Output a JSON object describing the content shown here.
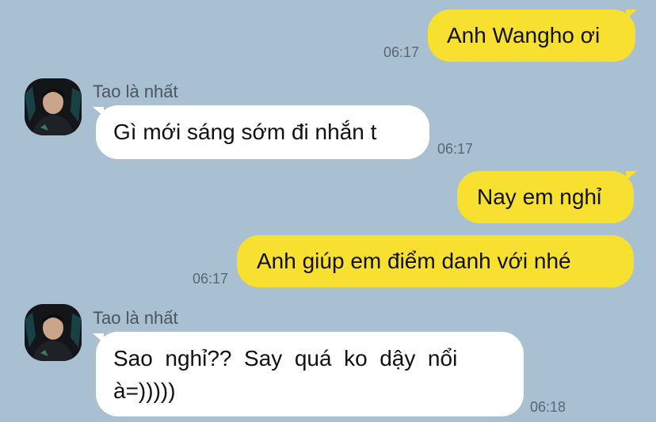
{
  "contact": {
    "name": "Tao là nhất"
  },
  "messages": [
    {
      "dir": "out",
      "text": "Anh Wangho ơi",
      "time": "06:17"
    },
    {
      "dir": "in",
      "sender": "Tao là nhất",
      "text": "Gì mới sáng sớm đi nhắn t",
      "time": "06:17"
    },
    {
      "dir": "out",
      "text": "Nay em nghỉ",
      "time": ""
    },
    {
      "dir": "out",
      "text": "Anh giúp em điểm danh với nhé",
      "time": "06:17"
    },
    {
      "dir": "in",
      "sender": "Tao là nhất",
      "text_line1": "Sao  nghỉ??  Say  quá  ko  dậy  nổi",
      "text_line2": "à=)))))",
      "time": "06:18"
    }
  ]
}
